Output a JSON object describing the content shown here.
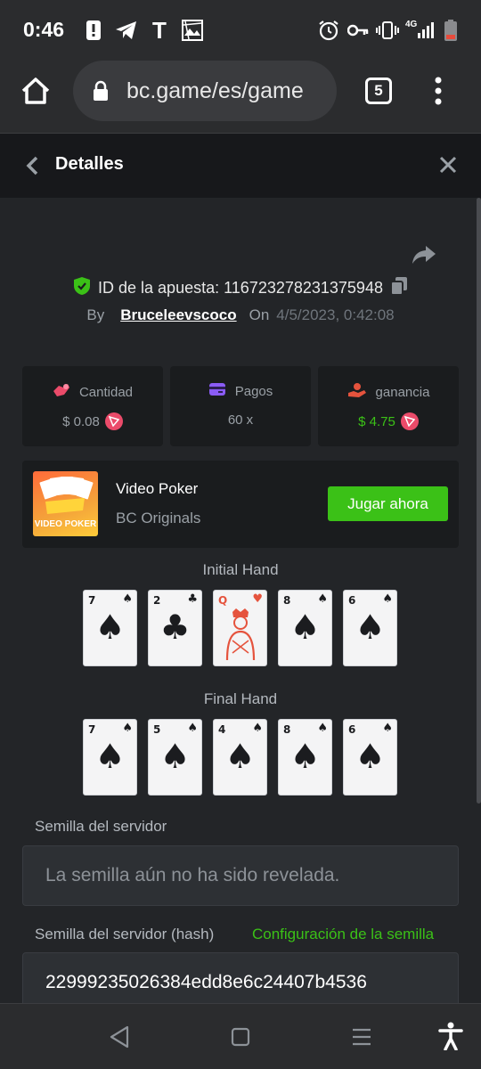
{
  "status_bar": {
    "time": "0:46",
    "icons": [
      "alert-icon",
      "telegram-icon",
      "t-icon",
      "photo-icon",
      "alarm-icon",
      "key-icon",
      "vibrate-icon",
      "signal-icon",
      "battery-icon"
    ],
    "network_label": "4G"
  },
  "browser": {
    "url": "bc.game/es/game",
    "tab_count": "5",
    "icons": [
      "home-icon",
      "lock-icon",
      "menu-dots-icon"
    ]
  },
  "header": {
    "title": "Detalles"
  },
  "bet": {
    "id_label": "ID de la apuesta: 116723278231375948",
    "by_label": "By",
    "username": "Bruceleevscoco",
    "on_label": "On",
    "datetime": "4/5/2023, 0:42:08"
  },
  "stats": [
    {
      "label": "Cantidad",
      "value": "$ 0.08",
      "icon": "cantidad-icon",
      "value_color": "#9aa0a6",
      "coin": true
    },
    {
      "label": "Pagos",
      "value": "60 x",
      "icon": "pagos-icon",
      "value_color": "#9aa0a6",
      "coin": false
    },
    {
      "label": "ganancia",
      "value": "$ 4.75",
      "icon": "ganancia-icon",
      "value_color": "#3bc117",
      "coin": true
    }
  ],
  "game": {
    "name": "Video Poker",
    "provider": "BC Originals",
    "play_label": "Jugar ahora",
    "thumb_text": "VIDEO POKER"
  },
  "initial_hand": {
    "label": "Initial Hand",
    "cards": [
      {
        "rank": "7",
        "suit": "♠",
        "color": "#1b1c1f"
      },
      {
        "rank": "2",
        "suit": "♣",
        "color": "#1b1c1f"
      },
      {
        "rank": "Q",
        "suit": "♥",
        "color": "#e5533d",
        "face": true
      },
      {
        "rank": "8",
        "suit": "♠",
        "color": "#1b1c1f"
      },
      {
        "rank": "6",
        "suit": "♠",
        "color": "#1b1c1f"
      }
    ]
  },
  "final_hand": {
    "label": "Final Hand",
    "cards": [
      {
        "rank": "7",
        "suit": "♠",
        "color": "#1b1c1f"
      },
      {
        "rank": "5",
        "suit": "♠",
        "color": "#1b1c1f"
      },
      {
        "rank": "4",
        "suit": "♠",
        "color": "#1b1c1f"
      },
      {
        "rank": "8",
        "suit": "♠",
        "color": "#1b1c1f"
      },
      {
        "rank": "6",
        "suit": "♠",
        "color": "#1b1c1f"
      }
    ]
  },
  "seed": {
    "server_label": "Semilla del servidor",
    "server_value": "La semilla aún no ha sido revelada.",
    "hash_label": "Semilla del servidor (hash)",
    "config_link": "Configuración de la semilla",
    "hash_value": "22999235026384edd8e6c24407b4536"
  },
  "colors": {
    "accent_green": "#3bc117",
    "shield_green": "#3bc117",
    "trx_red": "#eb4b6a",
    "heart_red": "#e5533d"
  }
}
